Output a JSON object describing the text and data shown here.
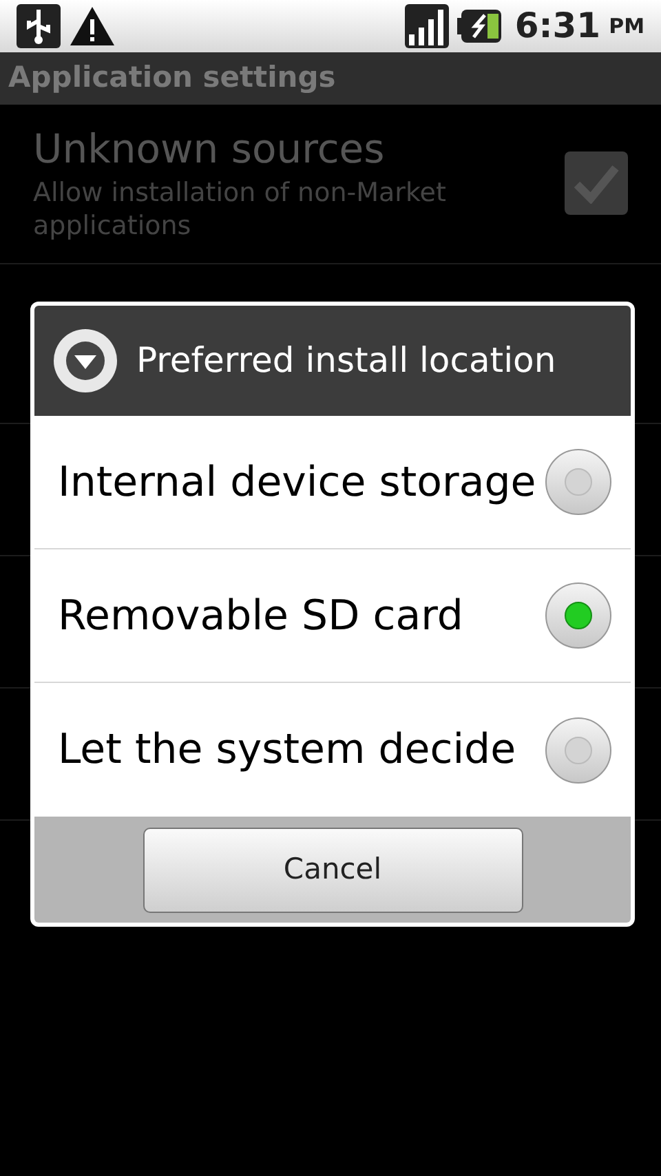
{
  "status_bar": {
    "time": "6:31",
    "ampm": "PM"
  },
  "title_bar": {
    "title": "Application settings"
  },
  "settings": [
    {
      "kind": "checkbox",
      "title": "Unknown sources",
      "summary": "Allow installation of non-Market applications",
      "checked": true
    }
  ],
  "dialog": {
    "title": "Preferred install location",
    "options": [
      {
        "label": "Internal device storage",
        "selected": false
      },
      {
        "label": "Removable SD card",
        "selected": true
      },
      {
        "label": "Let the system decide",
        "selected": false
      }
    ],
    "button": "Cancel"
  }
}
